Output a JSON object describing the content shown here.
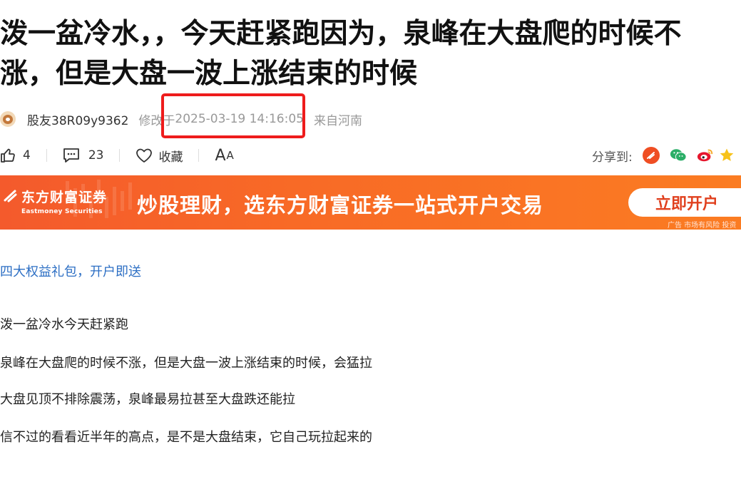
{
  "article": {
    "title_line1": "泼一盆冷水，，今天赶紧跑因为，泉峰在大盘爬的时候不",
    "title_line2": "涨，但是大盘一波上涨结束的时候",
    "author": "股友38R09y9362",
    "modified_label": "修改于",
    "modified_time": "2025-03-19 14:16:05",
    "location": "来自河南",
    "paragraphs": [
      "泼一盆冷水今天赶紧跑",
      "泉峰在大盘爬的时候不涨，但是大盘一波上涨结束的时候，会猛拉",
      "大盘见顶不排除震荡，泉峰最易拉甚至大盘跌还能拉",
      "信不过的看看近半年的高点，是不是大盘结束，它自己玩拉起来的"
    ]
  },
  "actions": {
    "like_count": "4",
    "comment_count": "23",
    "favorite_label": "收藏",
    "font_label_big": "A",
    "font_label_small": "A",
    "share_label": "分享到:"
  },
  "banner": {
    "brand_cn": "东方财富证券",
    "brand_en": "Eastmoney Securities",
    "slogan": "炒股理财，选东方财富证券一站式开户交易",
    "button": "立即开户",
    "ad_note": "广告 市场有风险 投资"
  },
  "promo_link": "四大权益礼包，开户即送",
  "colors": {
    "highlight_border": "#ee1c1c",
    "banner_orange": "#f86a26",
    "link_blue": "#2d6fc4",
    "weibo_red": "#e6162d",
    "wechat_green": "#2aae67"
  },
  "icons": [
    "avatar",
    "thumb-up-icon",
    "comment-icon",
    "heart-icon",
    "share-eastmoney-icon",
    "wechat-icon",
    "weibo-icon",
    "star-icon"
  ]
}
